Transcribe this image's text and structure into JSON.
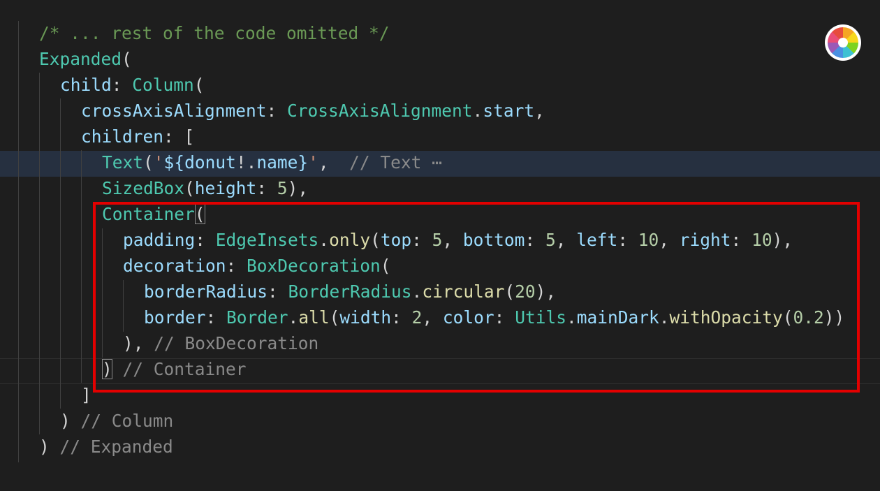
{
  "editor": {
    "lines": [
      [
        {
          "t": "/* ... rest of the code omitted */",
          "c": "c-comment"
        }
      ],
      [
        {
          "t": "Expanded",
          "c": "c-class"
        },
        {
          "t": "(",
          "c": "c-punc"
        }
      ],
      [
        {
          "t": "child",
          "c": "c-prop"
        },
        {
          "t": ": ",
          "c": "c-punc"
        },
        {
          "t": "Column",
          "c": "c-class"
        },
        {
          "t": "(",
          "c": "c-punc"
        }
      ],
      [
        {
          "t": "crossAxisAlignment",
          "c": "c-prop"
        },
        {
          "t": ": ",
          "c": "c-punc"
        },
        {
          "t": "CrossAxisAlignment",
          "c": "c-class"
        },
        {
          "t": ".",
          "c": "c-punc"
        },
        {
          "t": "start",
          "c": "c-var"
        },
        {
          "t": ",",
          "c": "c-punc"
        }
      ],
      [
        {
          "t": "children",
          "c": "c-prop"
        },
        {
          "t": ": [",
          "c": "c-punc"
        }
      ],
      [
        {
          "t": "Text",
          "c": "c-class"
        },
        {
          "t": "(",
          "c": "c-punc"
        },
        {
          "t": "'",
          "c": "c-str"
        },
        {
          "t": "${",
          "c": "c-prop"
        },
        {
          "t": "donut",
          "c": "c-var"
        },
        {
          "t": "!.",
          "c": "c-punc"
        },
        {
          "t": "name",
          "c": "c-var"
        },
        {
          "t": "}",
          "c": "c-prop"
        },
        {
          "t": "'",
          "c": "c-str"
        },
        {
          "t": ",  ",
          "c": "c-punc"
        },
        {
          "t": "// Text ⋯",
          "c": "c-gray"
        }
      ],
      [
        {
          "t": "SizedBox",
          "c": "c-class"
        },
        {
          "t": "(",
          "c": "c-punc"
        },
        {
          "t": "height",
          "c": "c-prop"
        },
        {
          "t": ": ",
          "c": "c-punc"
        },
        {
          "t": "5",
          "c": "c-num"
        },
        {
          "t": "),",
          "c": "c-punc"
        }
      ],
      [
        {
          "t": "Container",
          "c": "c-class"
        },
        {
          "t": "(",
          "c": "c-punc bracket-box"
        }
      ],
      [
        {
          "t": "padding",
          "c": "c-prop"
        },
        {
          "t": ": ",
          "c": "c-punc"
        },
        {
          "t": "EdgeInsets",
          "c": "c-class"
        },
        {
          "t": ".",
          "c": "c-punc"
        },
        {
          "t": "only",
          "c": "c-fn"
        },
        {
          "t": "(",
          "c": "c-punc"
        },
        {
          "t": "top",
          "c": "c-prop"
        },
        {
          "t": ": ",
          "c": "c-punc"
        },
        {
          "t": "5",
          "c": "c-num"
        },
        {
          "t": ", ",
          "c": "c-punc"
        },
        {
          "t": "bottom",
          "c": "c-prop"
        },
        {
          "t": ": ",
          "c": "c-punc"
        },
        {
          "t": "5",
          "c": "c-num"
        },
        {
          "t": ", ",
          "c": "c-punc"
        },
        {
          "t": "left",
          "c": "c-prop"
        },
        {
          "t": ": ",
          "c": "c-punc"
        },
        {
          "t": "10",
          "c": "c-num"
        },
        {
          "t": ", ",
          "c": "c-punc"
        },
        {
          "t": "right",
          "c": "c-prop"
        },
        {
          "t": ": ",
          "c": "c-punc"
        },
        {
          "t": "10",
          "c": "c-num"
        },
        {
          "t": "),",
          "c": "c-punc"
        }
      ],
      [
        {
          "t": "decoration",
          "c": "c-prop"
        },
        {
          "t": ": ",
          "c": "c-punc"
        },
        {
          "t": "BoxDecoration",
          "c": "c-class"
        },
        {
          "t": "(",
          "c": "c-punc"
        }
      ],
      [
        {
          "t": "borderRadius",
          "c": "c-prop"
        },
        {
          "t": ": ",
          "c": "c-punc"
        },
        {
          "t": "BorderRadius",
          "c": "c-class"
        },
        {
          "t": ".",
          "c": "c-punc"
        },
        {
          "t": "circular",
          "c": "c-fn"
        },
        {
          "t": "(",
          "c": "c-punc"
        },
        {
          "t": "20",
          "c": "c-num"
        },
        {
          "t": "),",
          "c": "c-punc"
        }
      ],
      [
        {
          "t": "border",
          "c": "c-prop"
        },
        {
          "t": ": ",
          "c": "c-punc"
        },
        {
          "t": "Border",
          "c": "c-class"
        },
        {
          "t": ".",
          "c": "c-punc"
        },
        {
          "t": "all",
          "c": "c-fn"
        },
        {
          "t": "(",
          "c": "c-punc"
        },
        {
          "t": "width",
          "c": "c-prop"
        },
        {
          "t": ": ",
          "c": "c-punc"
        },
        {
          "t": "2",
          "c": "c-num"
        },
        {
          "t": ", ",
          "c": "c-punc"
        },
        {
          "t": "color",
          "c": "c-prop"
        },
        {
          "t": ": ",
          "c": "c-punc"
        },
        {
          "t": "Utils",
          "c": "c-class"
        },
        {
          "t": ".",
          "c": "c-punc"
        },
        {
          "t": "mainDark",
          "c": "c-var"
        },
        {
          "t": ".",
          "c": "c-punc"
        },
        {
          "t": "withOpacity",
          "c": "c-fn"
        },
        {
          "t": "(",
          "c": "c-punc"
        },
        {
          "t": "0.2",
          "c": "c-num"
        },
        {
          "t": "))",
          "c": "c-punc"
        }
      ],
      [
        {
          "t": "), ",
          "c": "c-punc"
        },
        {
          "t": "// BoxDecoration",
          "c": "c-gray"
        }
      ],
      [
        {
          "t": ")",
          "c": "c-punc bracket-box"
        },
        {
          "t": " ",
          "c": "c-punc"
        },
        {
          "t": "// Container",
          "c": "c-gray"
        }
      ],
      [
        {
          "t": "]",
          "c": "c-punc"
        }
      ],
      [
        {
          "t": ") ",
          "c": "c-punc"
        },
        {
          "t": "// Column",
          "c": "c-gray"
        }
      ],
      [
        {
          "t": ") ",
          "c": "c-punc"
        },
        {
          "t": "// Expanded",
          "c": "c-gray"
        }
      ]
    ]
  },
  "colors": {
    "background": "#1e1e1e",
    "highlight_box": "#e30000",
    "comment": "#6a9955",
    "class": "#4ec9b0",
    "property": "#9cdcfe",
    "number": "#b5cea8",
    "function": "#dcdcaa"
  },
  "icons": {
    "app_logo": "color-wheel-icon"
  }
}
